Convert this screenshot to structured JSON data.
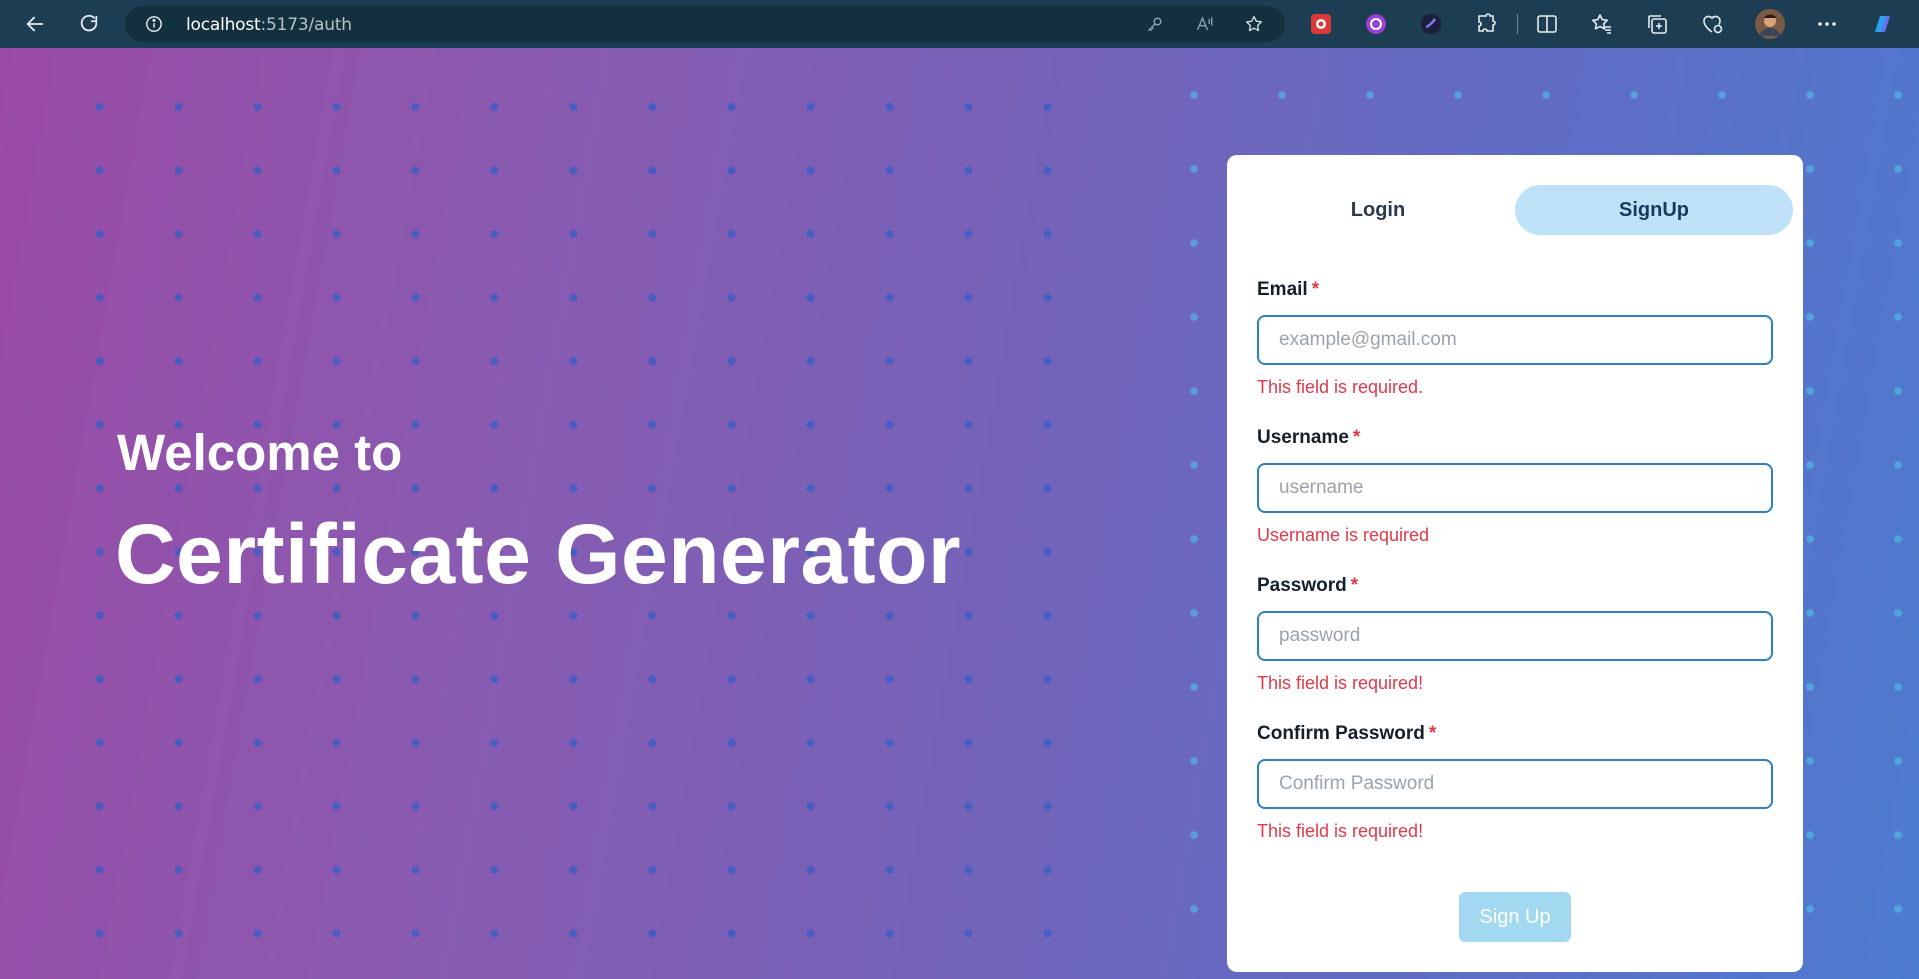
{
  "browser": {
    "url_host": "localhost",
    "url_path": ":5173/auth",
    "icons": [
      "back-icon",
      "refresh-icon",
      "site-info-icon",
      "key-icon",
      "read-aloud-icon",
      "favorite-star-icon",
      "extension-red-icon",
      "extension-purple-icon",
      "extension-dark-icon",
      "extensions-puzzle-icon",
      "split-screen-icon",
      "favorites-icon",
      "collections-icon",
      "browser-essentials-icon",
      "profile-avatar",
      "more-icon",
      "copilot-icon"
    ]
  },
  "hero": {
    "welcome": "Welcome to",
    "title": "Certificate Generator"
  },
  "auth": {
    "tabs": [
      {
        "label": "Login",
        "active": false
      },
      {
        "label": "SignUp",
        "active": true
      }
    ],
    "required_mark": "*",
    "fields": [
      {
        "label": "Email",
        "placeholder": "example@gmail.com",
        "value": "",
        "error": "This field is required."
      },
      {
        "label": "Username",
        "placeholder": "username",
        "value": "",
        "error": "Username is required"
      },
      {
        "label": "Password",
        "placeholder": "password",
        "value": "",
        "error": "This field is required!"
      },
      {
        "label": "Confirm Password",
        "placeholder": "Confirm Password",
        "value": "",
        "error": "This field is required!"
      }
    ],
    "submit_label": "Sign Up"
  },
  "colors": {
    "accent": "#2f7fbf",
    "error": "#e0394a",
    "active_tab": "#c0e2f8",
    "submit_disabled": "#a3d9f0"
  }
}
